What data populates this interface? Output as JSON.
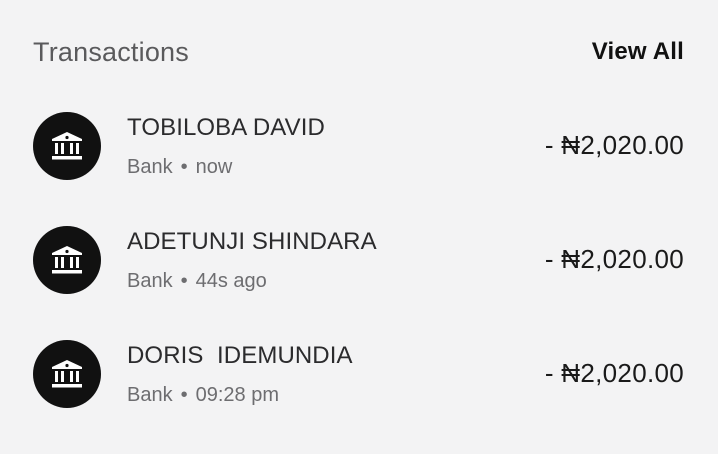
{
  "header": {
    "title": "Transactions",
    "view_all_label": "View All"
  },
  "transactions": [
    {
      "name": "TOBILOBA DAVID",
      "method": "Bank",
      "time": "now",
      "amount": "- ₦2,020.00",
      "icon": "bank-icon"
    },
    {
      "name": "ADETUNJI SHINDARA",
      "method": "Bank",
      "time": "44s ago",
      "amount": "- ₦2,020.00",
      "icon": "bank-icon"
    },
    {
      "name": "DORIS  IDEMUNDIA",
      "method": "Bank",
      "time": "09:28 pm",
      "amount": "- ₦2,020.00",
      "icon": "bank-icon"
    }
  ],
  "colors": {
    "background": "#f3f3f4",
    "icon_bg": "#111111",
    "title": "#5a5a5c",
    "text_primary": "#2b2b2d",
    "text_secondary": "#6d6d70"
  }
}
